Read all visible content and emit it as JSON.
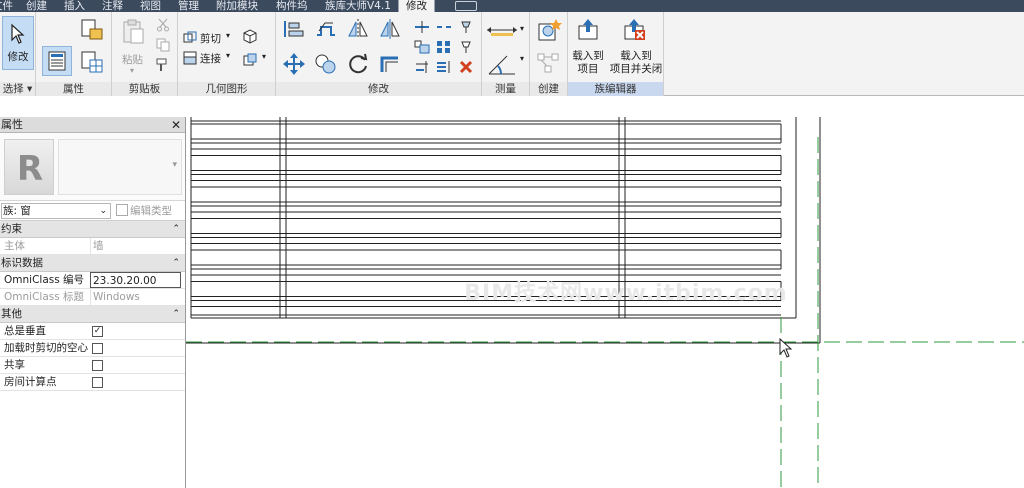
{
  "menu": {
    "tabs": [
      "文件",
      "创建",
      "插入",
      "注释",
      "视图",
      "管理",
      "附加模块",
      "构件坞",
      "族库大师V4.1",
      "修改"
    ],
    "active_tab": "修改"
  },
  "ribbon": {
    "select": {
      "modify_label": "修改",
      "panel_label": "选择 ▾"
    },
    "properties": {
      "panel_label": "属性"
    },
    "clipboard": {
      "paste_label": "粘贴",
      "panel_label": "剪贴板"
    },
    "geometry": {
      "cut_label": "剪切",
      "join_label": "连接",
      "panel_label": "几何图形"
    },
    "modify": {
      "panel_label": "修改"
    },
    "measure": {
      "panel_label": "测量"
    },
    "create": {
      "panel_label": "创建"
    },
    "family_editor": {
      "load_into_project_line1": "载入到",
      "load_into_project_line2": "项目",
      "load_and_close_line1": "载入到",
      "load_and_close_line2": "项目并关闭",
      "panel_label": "族编辑器"
    }
  },
  "properties": {
    "title": "属性",
    "family_type": "族: 窗",
    "edit_type_label": "编辑类型",
    "sections": {
      "constraints": "约束",
      "identity": "标识数据",
      "other": "其他"
    },
    "host_label": "主体",
    "host_value": "墙",
    "omniclass_number_label": "OmniClass 编号",
    "omniclass_number_value": "23.30.20.00",
    "omniclass_title_label": "OmniClass 标题",
    "omniclass_title_value": "Windows",
    "always_vertical_label": "总是垂直",
    "always_vertical_checked": true,
    "cut_with_voids_label": "加载时剪切的空心",
    "cut_with_voids_checked": false,
    "shared_label": "共享",
    "shared_checked": false,
    "room_calc_label": "房间计算点",
    "room_calc_checked": false
  },
  "watermark": "BIM技术网www.itbim.com",
  "colors": {
    "menubar": "#3c4a5e",
    "ribbon": "#f3f3f3",
    "accent_blue": "#2a6fb3",
    "reference_plane_green": "#2f9a3c"
  }
}
